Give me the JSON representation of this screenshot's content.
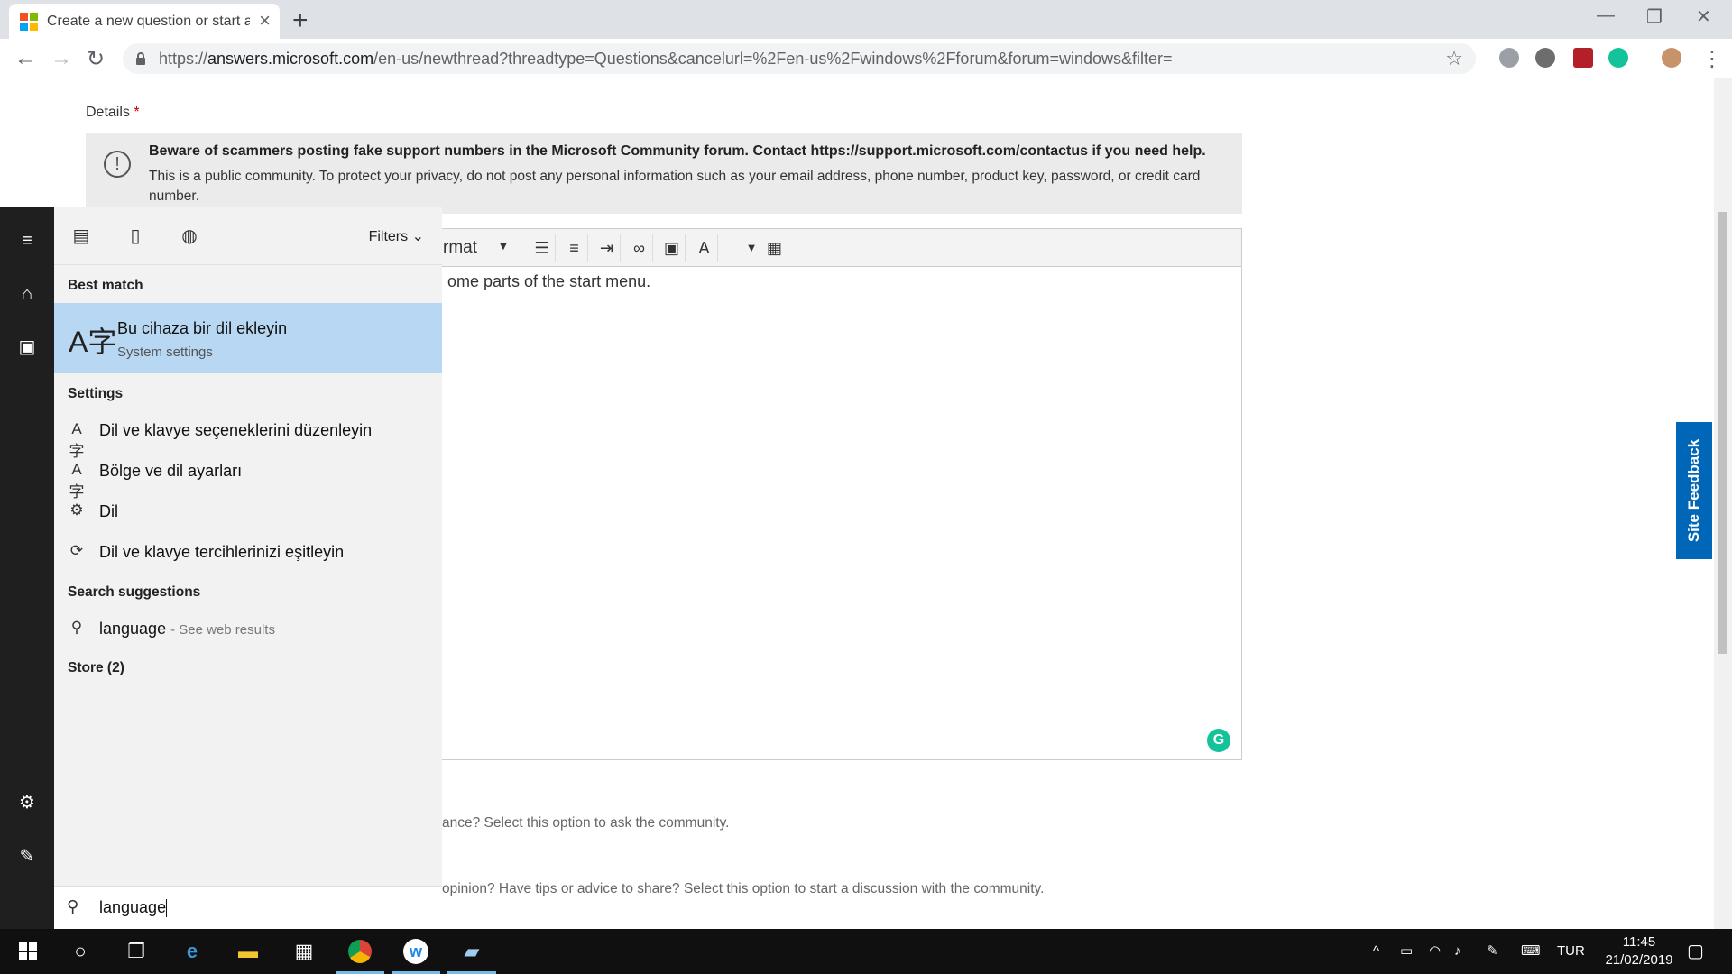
{
  "browser": {
    "tab_title": "Create a new question or start a",
    "url_prefix": "https://",
    "url_host": "answers.microsoft.com",
    "url_path": "/en-us/newthread?threadtype=Questions&cancelurl=%2Fen-us%2Fwindows%2Fforum&forum=windows&filter="
  },
  "page": {
    "details_label": "Details",
    "required_mark": "*",
    "notice_bold": "Beware of scammers posting fake support numbers in the Microsoft Community forum. Contact https://support.microsoft.com/contactus if you need help.",
    "notice_text": "This is a public community. To protect your privacy, do not post any personal information such as your email address, phone number, product key, password, or credit card number.",
    "editor_format_fragment": "rmat",
    "editor_body_fragment": "ome parts of the start menu.",
    "option_question_fragment": "ance? Select this option to ask the community.",
    "option_discussion_fragment": "opinion? Have tips or advice to share? Select this option to start a discussion with the community.",
    "site_feedback": "Site Feedback"
  },
  "start_menu": {
    "filters_label": "Filters",
    "best_match_heading": "Best match",
    "best_match": {
      "title": "Bu cihaza bir dil ekleyin",
      "subtitle": "System settings"
    },
    "settings_heading": "Settings",
    "settings_items": [
      {
        "label": "Dil ve klavye seçeneklerini düzenleyin",
        "icon": "language-icon"
      },
      {
        "label": "Bölge ve dil ayarları",
        "icon": "language-icon"
      },
      {
        "label": "Dil",
        "icon": "gear-icon"
      },
      {
        "label": "Dil ve klavye tercihlerinizi eşitleyin",
        "icon": "sync-icon"
      }
    ],
    "suggestions_heading": "Search suggestions",
    "suggestion": {
      "term": "language",
      "hint": "- See web results"
    },
    "store_heading": "Store (2)",
    "search_value": "language"
  },
  "taskbar": {
    "language": "TUR",
    "time": "11:45",
    "date": "21/02/2019"
  },
  "colors": {
    "start_highlight": "#b7d7f2",
    "feedback_blue": "#0067b8",
    "taskbar_bg": "#101010"
  }
}
